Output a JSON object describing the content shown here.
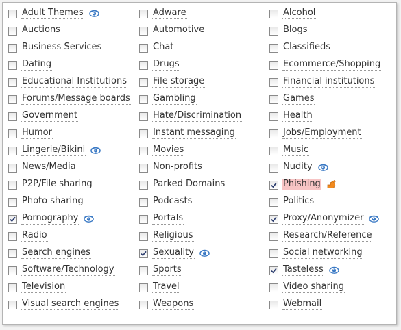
{
  "columns": [
    [
      {
        "label": "Adult Themes",
        "checked": false,
        "icon": "eye-icon"
      },
      {
        "label": "Auctions",
        "checked": false
      },
      {
        "label": "Business Services",
        "checked": false
      },
      {
        "label": "Dating",
        "checked": false
      },
      {
        "label": "Educational Institutions",
        "checked": false
      },
      {
        "label": "Forums/Message boards",
        "checked": false
      },
      {
        "label": "Government",
        "checked": false
      },
      {
        "label": "Humor",
        "checked": false
      },
      {
        "label": "Lingerie/Bikini",
        "checked": false,
        "icon": "eye-icon"
      },
      {
        "label": "News/Media",
        "checked": false
      },
      {
        "label": "P2P/File sharing",
        "checked": false
      },
      {
        "label": "Photo sharing",
        "checked": false
      },
      {
        "label": "Pornography",
        "checked": true,
        "icon": "eye-icon"
      },
      {
        "label": "Radio",
        "checked": false
      },
      {
        "label": "Search engines",
        "checked": false
      },
      {
        "label": "Software/Technology",
        "checked": false
      },
      {
        "label": "Television",
        "checked": false
      },
      {
        "label": "Visual search engines",
        "checked": false
      }
    ],
    [
      {
        "label": "Adware",
        "checked": false
      },
      {
        "label": "Automotive",
        "checked": false
      },
      {
        "label": "Chat",
        "checked": false
      },
      {
        "label": "Drugs",
        "checked": false
      },
      {
        "label": "File storage",
        "checked": false
      },
      {
        "label": "Gambling",
        "checked": false
      },
      {
        "label": "Hate/Discrimination",
        "checked": false
      },
      {
        "label": "Instant messaging",
        "checked": false
      },
      {
        "label": "Movies",
        "checked": false
      },
      {
        "label": "Non-profits",
        "checked": false
      },
      {
        "label": "Parked Domains",
        "checked": false
      },
      {
        "label": "Podcasts",
        "checked": false
      },
      {
        "label": "Portals",
        "checked": false
      },
      {
        "label": "Religious",
        "checked": false
      },
      {
        "label": "Sexuality",
        "checked": true,
        "icon": "eye-icon"
      },
      {
        "label": "Sports",
        "checked": false
      },
      {
        "label": "Travel",
        "checked": false
      },
      {
        "label": "Weapons",
        "checked": false
      }
    ],
    [
      {
        "label": "Alcohol",
        "checked": false
      },
      {
        "label": "Blogs",
        "checked": false
      },
      {
        "label": "Classifieds",
        "checked": false
      },
      {
        "label": "Ecommerce/Shopping",
        "checked": false
      },
      {
        "label": "Financial institutions",
        "checked": false
      },
      {
        "label": "Games",
        "checked": false
      },
      {
        "label": "Health",
        "checked": false
      },
      {
        "label": "Jobs/Employment",
        "checked": false
      },
      {
        "label": "Music",
        "checked": false
      },
      {
        "label": "Nudity",
        "checked": false,
        "icon": "eye-icon"
      },
      {
        "label": "Phishing",
        "checked": true,
        "icon": "pointing-hand-icon",
        "highlight": true
      },
      {
        "label": "Politics",
        "checked": false
      },
      {
        "label": "Proxy/Anonymizer",
        "checked": true,
        "icon": "eye-icon"
      },
      {
        "label": "Research/Reference",
        "checked": false
      },
      {
        "label": "Social networking",
        "checked": false
      },
      {
        "label": "Tasteless",
        "checked": true,
        "icon": "eye-icon"
      },
      {
        "label": "Video sharing",
        "checked": false
      },
      {
        "label": "Webmail",
        "checked": false
      }
    ]
  ],
  "colors": {
    "highlight": "#f7c4c4",
    "text": "#333333",
    "eye_icon": "#3a79c4",
    "hand_icon": "#f28a1e"
  }
}
